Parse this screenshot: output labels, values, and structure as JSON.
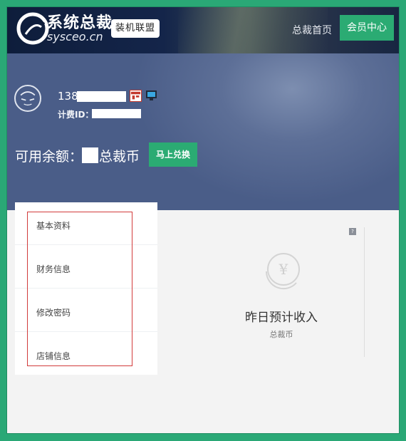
{
  "header": {
    "logo_title": "系统总裁",
    "logo_subtitle": "sysceo.cn",
    "league_badge": "装机联盟",
    "nav_home": "总裁首页",
    "nav_member": "会员中心"
  },
  "profile": {
    "phone_prefix": "138",
    "fee_id_label": "计费ID：",
    "balance_label": "可用余额：",
    "balance_unit": "总裁币",
    "exchange_button": "马上兑换"
  },
  "menu": {
    "items": [
      {
        "label": "基本资料"
      },
      {
        "label": "财务信息"
      },
      {
        "label": "修改密码"
      },
      {
        "label": "店铺信息"
      }
    ]
  },
  "stat": {
    "coin_symbol": "¥",
    "help_icon": "?",
    "title": "昨日预计收入",
    "unit": "总裁币"
  },
  "colors": {
    "accent_green": "#2bab73",
    "header_dark": "#0e1d3b",
    "band_blue": "#4a5d88",
    "highlight_red": "#d23b3b"
  },
  "icons": [
    "logo-swirl-icon",
    "avatar-face-icon",
    "shop-icon",
    "computer-icon",
    "help-icon",
    "yuan-coin-icon"
  ]
}
